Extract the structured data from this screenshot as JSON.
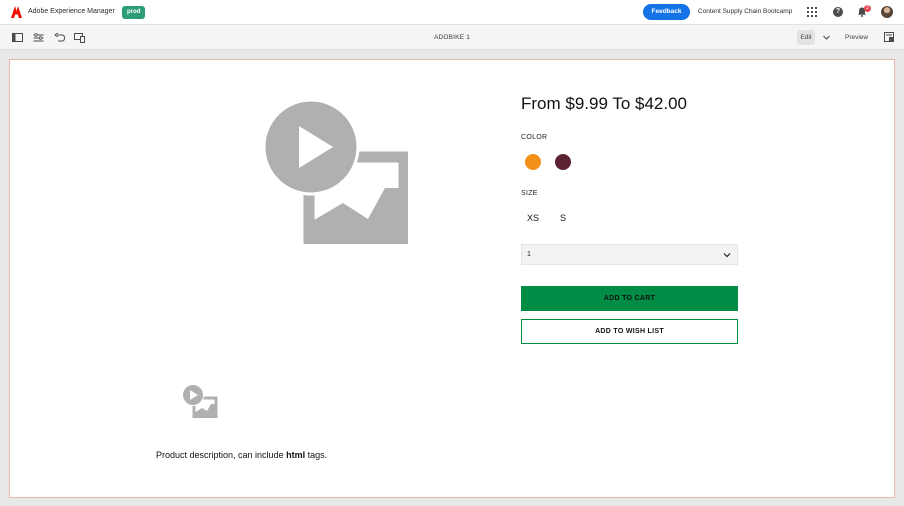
{
  "header": {
    "app_title": "Adobe Experience Manager",
    "env_badge": "prod",
    "feedback_label": "Feedback",
    "org_name": "Content Supply Chain Bootcamp",
    "notification_count": "2"
  },
  "toolbar": {
    "page_name": "ADOBIKE 1",
    "edit_label": "Edit",
    "preview_label": "Preview"
  },
  "product": {
    "price": "From $9.99 To $42.00",
    "color_label": "COLOR",
    "colors": [
      "#f39019",
      "#5b2332"
    ],
    "size_label": "SIZE",
    "sizes": [
      "XS",
      "S"
    ],
    "quantity": "1",
    "add_to_cart_label": "ADD TO CART",
    "add_to_wish_list_label": "ADD TO WISH LIST",
    "description_prefix": "Product description, can include ",
    "description_bold": "html",
    "description_suffix": " tags."
  }
}
